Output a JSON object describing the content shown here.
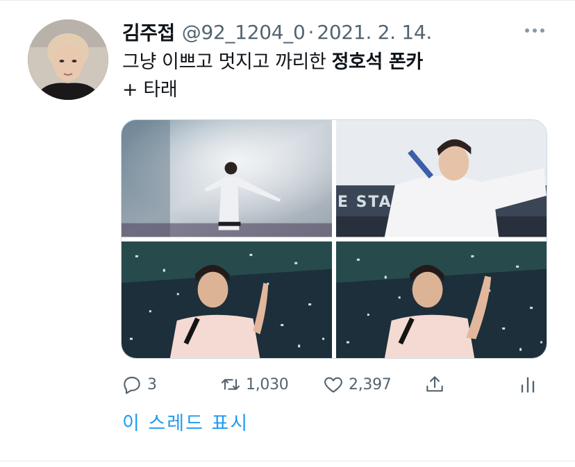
{
  "tweet": {
    "display_name": "김주접",
    "handle": "@92_1204_0",
    "separator": "·",
    "date": "2021. 2. 14.",
    "text_part1": "그냥 이쁘고 멋지고 까리한 ",
    "text_bold": "정호석 폰카",
    "text_line2": "+ 타래",
    "photo_stadium_text": "E STADIU",
    "counts": {
      "replies": "3",
      "retweets": "1,030",
      "likes": "2,397"
    },
    "show_thread": "이 스레드 표시"
  },
  "icons": {
    "more": "more-dots-icon",
    "reply": "reply-icon",
    "retweet": "retweet-icon",
    "like": "heart-icon",
    "share": "share-icon",
    "analytics": "analytics-icon"
  },
  "colors": {
    "text": "#0f1419",
    "secondary": "#536471",
    "link": "#1d9bf0",
    "border": "#cfd9de"
  }
}
